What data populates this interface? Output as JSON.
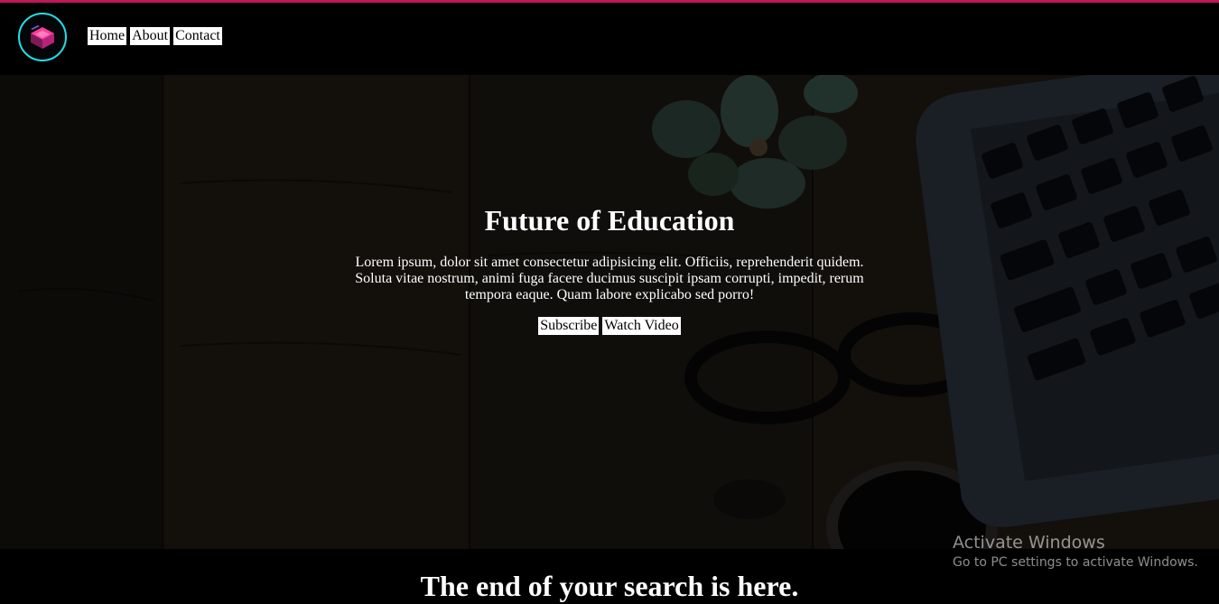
{
  "nav": {
    "logo_icon": "layered-cube-logo-icon",
    "accent_color": "#c2185b",
    "logo_ring_color": "#1fe0e8",
    "links": [
      {
        "label": "Home"
      },
      {
        "label": "About"
      },
      {
        "label": "Contact"
      }
    ]
  },
  "hero": {
    "title": "Future of Education",
    "text": "Lorem ipsum, dolor sit amet consectetur adipisicing elit. Officiis, reprehenderit quidem. Soluta vitae nostrum, animi fuga facere ducimus suscipit ipsam corrupti, impedit, rerum tempora eaque. Quam labore explicabo sed porro!",
    "subscribe_label": "Subscribe",
    "watch_label": "Watch Video",
    "background_icons": [
      "desk-wood-background",
      "plant-image",
      "glasses-image",
      "coffee-cup-image",
      "laptop-keyboard-image"
    ]
  },
  "section": {
    "tagline": "The end of your search is here."
  },
  "watermark": {
    "title": "Activate Windows",
    "subtitle": "Go to PC settings to activate Windows."
  }
}
